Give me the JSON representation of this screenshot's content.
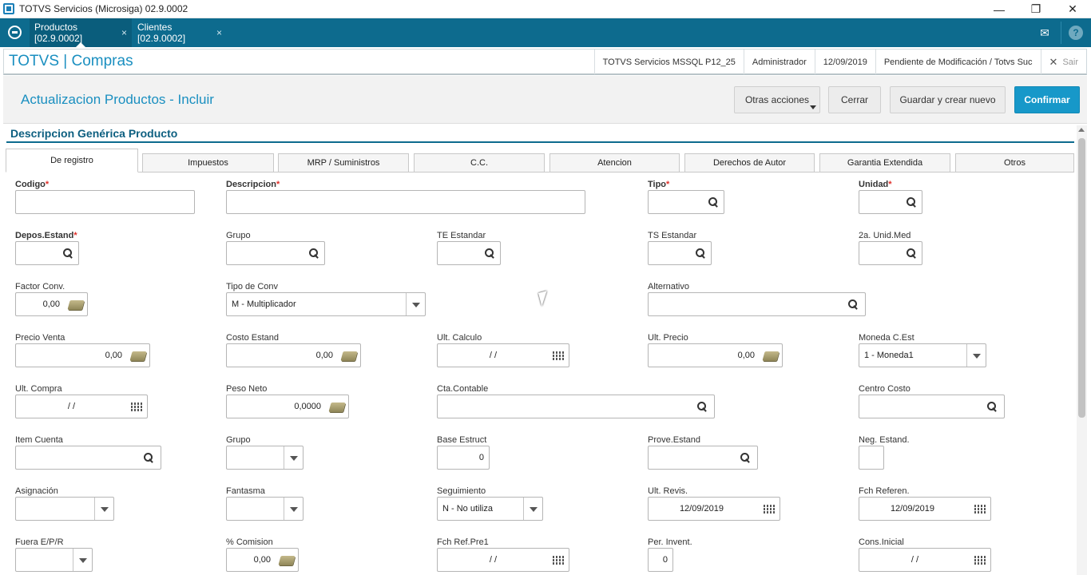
{
  "window": {
    "title": "TOTVS Servicios (Microsiga) 02.9.0002",
    "minimize": "—",
    "restore": "❐",
    "close": "✕"
  },
  "apptabs": [
    {
      "label": "Productos [02.9.0002]",
      "close": "×"
    },
    {
      "label": "Clientes [02.9.0002]",
      "close": "×"
    }
  ],
  "tabsbar": {
    "mail_icon": "✉",
    "help_icon": "?"
  },
  "header": {
    "module": "TOTVS | Compras",
    "environment": "TOTVS Servicios MSSQL P12_25",
    "user": "Administrador",
    "date": "12/09/2019",
    "status": "Pendiente de Modificación / Totvs Suc",
    "exit_icon": "✕",
    "exit": "Sair"
  },
  "page": {
    "title": "Actualizacion Productos - Incluir",
    "buttons": {
      "other_actions": "Otras acciones",
      "close": "Cerrar",
      "save_new": "Guardar y crear nuevo",
      "confirm": "Confirmar"
    }
  },
  "section": {
    "title": "Descripcion Genérica Producto"
  },
  "formtabs": [
    "De registro",
    "Impuestos",
    "MRP / Suministros",
    "C.C.",
    "Atencion",
    "Derechos de Autor",
    "Garantia Extendida",
    "Otros"
  ],
  "required_mark": "*",
  "fields": {
    "codigo": {
      "label": "Codigo"
    },
    "descripcion": {
      "label": "Descripcion"
    },
    "tipo": {
      "label": "Tipo"
    },
    "unidad": {
      "label": "Unidad"
    },
    "depos_estand": {
      "label": "Depos.Estand"
    },
    "grupo": {
      "label": "Grupo"
    },
    "te_estandar": {
      "label": "TE Estandar"
    },
    "ts_estandar": {
      "label": "TS Estandar"
    },
    "unid_med2": {
      "label": "2a. Unid.Med"
    },
    "factor_conv": {
      "label": "Factor Conv.",
      "value": "0,00"
    },
    "tipo_conv": {
      "label": "Tipo de Conv",
      "value": "M - Multiplicador"
    },
    "alternativo": {
      "label": "Alternativo"
    },
    "precio_venta": {
      "label": "Precio Venta",
      "value": "0,00"
    },
    "costo_estand": {
      "label": "Costo Estand",
      "value": "0,00"
    },
    "ult_calculo": {
      "label": "Ult. Calculo",
      "value": "/  /"
    },
    "ult_precio": {
      "label": "Ult. Precio",
      "value": "0,00"
    },
    "moneda_cest": {
      "label": "Moneda C.Est",
      "value": "1 - Moneda1"
    },
    "ult_compra": {
      "label": "Ult. Compra",
      "value": "/  /"
    },
    "peso_neto": {
      "label": "Peso Neto",
      "value": "0,0000"
    },
    "cta_contable": {
      "label": "Cta.Contable"
    },
    "centro_costo": {
      "label": "Centro Costo"
    },
    "item_cuenta": {
      "label": "Item Cuenta"
    },
    "grupo2": {
      "label": "Grupo"
    },
    "base_estruct": {
      "label": "Base Estruct",
      "value": "0"
    },
    "prove_estand": {
      "label": "Prove.Estand"
    },
    "neg_estand": {
      "label": "Neg. Estand."
    },
    "asignacion": {
      "label": "Asignación"
    },
    "fantasma": {
      "label": "Fantasma"
    },
    "seguimiento": {
      "label": "Seguimiento",
      "value": "N - No utiliza"
    },
    "ult_revis": {
      "label": "Ult. Revis.",
      "value": "12/09/2019"
    },
    "fch_referen": {
      "label": "Fch Referen.",
      "value": "12/09/2019"
    },
    "fuera_epr": {
      "label": "Fuera E/P/R"
    },
    "pct_comision": {
      "label": "% Comision",
      "value": "0,00"
    },
    "fch_ref_pre1": {
      "label": "Fch Ref.Pre1",
      "value": "/  /"
    },
    "per_invent": {
      "label": "Per. Invent.",
      "value": "0"
    },
    "cons_inicial": {
      "label": "Cons.Inicial",
      "value": "/  /"
    }
  }
}
